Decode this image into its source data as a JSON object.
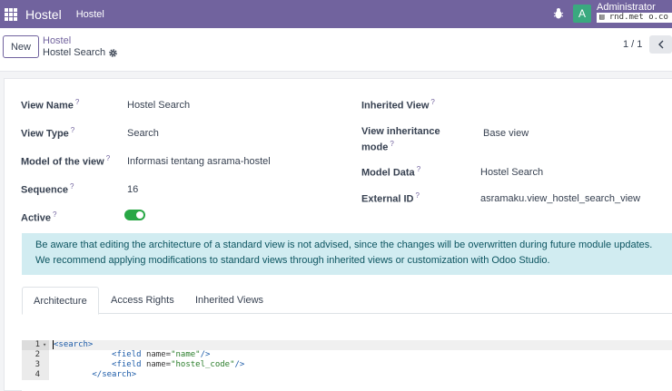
{
  "navbar": {
    "brand": "Hostel",
    "menu": "Hostel",
    "user": "Administrator",
    "database": "rnd.met          o.co",
    "avatar_letter": "A",
    "color": "#71639e"
  },
  "control_panel": {
    "new_label": "New",
    "breadcrumb_parent": "Hostel",
    "breadcrumb_current": "Hostel Search",
    "pager": "1 / 1"
  },
  "form": {
    "left": [
      {
        "label": "View Name",
        "value": "Hostel Search"
      },
      {
        "label": "View Type",
        "value": "Search"
      },
      {
        "label": "Model of the view",
        "value": "Informasi tentang asrama-hostel"
      },
      {
        "label": "Sequence",
        "value": "16"
      },
      {
        "label": "Active",
        "value": ""
      }
    ],
    "right": [
      {
        "label": "Inherited View",
        "value": ""
      },
      {
        "label": "View inheritance",
        "label2": "mode",
        "value": "Base view"
      },
      {
        "label": "Model Data",
        "value": "Hostel Search"
      },
      {
        "label": "External ID",
        "value": "asramaku.view_hostel_search_view"
      }
    ],
    "active": true
  },
  "alert": {
    "line1": "Be aware that editing the architecture of a standard view is not advised, since the changes will be overwritten during future module updates.",
    "line2": "We recommend applying modifications to standard views through inherited views or customization with Odoo Studio."
  },
  "tabs": [
    {
      "label": "Architecture",
      "active": true
    },
    {
      "label": "Access Rights",
      "active": false
    },
    {
      "label": "Inherited Views",
      "active": false
    }
  ],
  "code": {
    "lines": [
      {
        "no": "1",
        "indent": "",
        "open": "<search>",
        "body": ""
      },
      {
        "no": "2",
        "indent": "            ",
        "tag": "<field",
        "attr": " name=",
        "str": "\"name\"",
        "close": "/>"
      },
      {
        "no": "3",
        "indent": "            ",
        "tag": "<field",
        "attr": " name=",
        "str": "\"hostel_code\"",
        "close": "/>"
      },
      {
        "no": "4",
        "indent": "        ",
        "open": "</search>",
        "body": ""
      }
    ]
  }
}
